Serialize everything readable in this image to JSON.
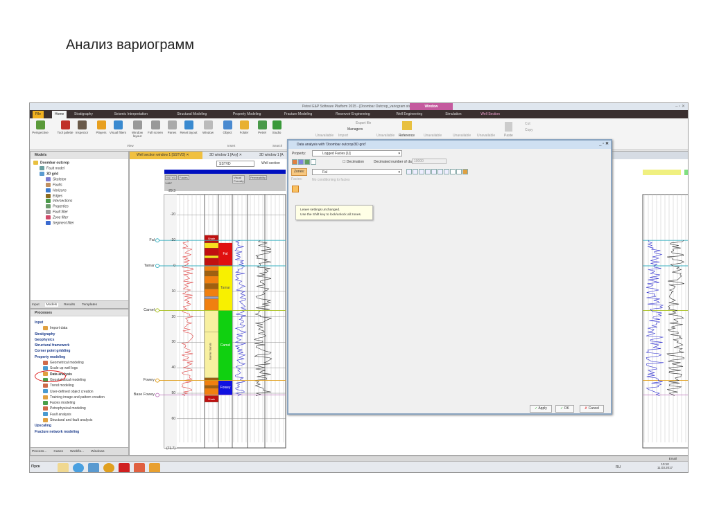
{
  "slide_title": "Анализ вариограмм",
  "window_title": "Petrel E&P Software Platform 2015 - [Doombar Outcrop_variogram study]",
  "context_tab": "Window",
  "ribbon_tabs": [
    "File",
    "Home",
    "Stratigraphy",
    "Seismic Interpretation",
    "Structural Modeling",
    "Property Modeling",
    "Fracture Modeling",
    "Reservoir Engineering",
    "Well Engineering",
    "Simulation",
    "Well Section"
  ],
  "ribbon_buttons": [
    {
      "label": "Perspective",
      "color": "#5a9a3a"
    },
    {
      "label": "Tool palette",
      "color": "#c0302a"
    },
    {
      "label": "Inspector",
      "color": "#6a5a4a"
    },
    {
      "label": "Players",
      "color": "#e8a020"
    },
    {
      "label": "Visual filters",
      "color": "#3a8ad0"
    },
    {
      "label": "Window layout",
      "color": "#999999"
    },
    {
      "label": "Full screen",
      "color": "#999999"
    },
    {
      "label": "Panes",
      "color": "#aaaaaa"
    },
    {
      "label": "Reset layout",
      "color": "#3a8ad0"
    },
    {
      "label": "Window",
      "color": "#bbbbbb"
    },
    {
      "label": "Object",
      "color": "#4a8ad0"
    },
    {
      "label": "Folder",
      "color": "#e8b030"
    },
    {
      "label": "Petrel",
      "color": "#4a9a4a"
    },
    {
      "label": "Studio",
      "color": "#3a9a3a"
    }
  ],
  "ribbon_groups": {
    "view": "View",
    "insert": "Insert",
    "search": "Search"
  },
  "ribbon_right": {
    "unavailable": "Unavailable",
    "import": "Import",
    "export": "Export file",
    "managers": "Managers",
    "reference": "Reference",
    "paste": "Paste",
    "cut": "Cut",
    "copy": "Copy"
  },
  "models_panel": {
    "title": "Models",
    "items": [
      {
        "label": "Doombar outcrop",
        "level": 0,
        "color": "#e8c040",
        "bold": true
      },
      {
        "label": "Fault model",
        "level": 1,
        "color": "#6aa0a0"
      },
      {
        "label": "3D grid",
        "level": 1,
        "color": "#5a9ad0",
        "bold": true
      },
      {
        "label": "Skeleton",
        "level": 2,
        "color": "#7a7ad0"
      },
      {
        "label": "Faults",
        "level": 2,
        "color": "#c09060"
      },
      {
        "label": "Horizons",
        "level": 2,
        "color": "#3a7ad0"
      },
      {
        "label": "Edges",
        "level": 2,
        "color": "#8a6a20"
      },
      {
        "label": "Intersections",
        "level": 2,
        "color": "#4a9a4a"
      },
      {
        "label": "Properties",
        "level": 2,
        "color": "#6a9a6a"
      },
      {
        "label": "Fault filter",
        "level": 2,
        "color": "#999999"
      },
      {
        "label": "Zone filter",
        "level": 2,
        "color": "#d04a6a"
      },
      {
        "label": "Segment filter",
        "level": 2,
        "color": "#3a6ad0"
      }
    ],
    "tabs": [
      "Input",
      "Models",
      "Results",
      "Templates"
    ]
  },
  "processes_panel": {
    "title": "Processes",
    "items": [
      {
        "label": "Input",
        "level": 0
      },
      {
        "label": "Import data",
        "level": 1
      },
      {
        "label": "Stratigraphy",
        "level": 0
      },
      {
        "label": "Geophysics",
        "level": 0
      },
      {
        "label": "Structural framework",
        "level": 0
      },
      {
        "label": "Corner point gridding",
        "level": 0
      },
      {
        "label": "Property modeling",
        "level": 0
      },
      {
        "label": "Geometrical modeling",
        "level": 1
      },
      {
        "label": "Scale up well logs",
        "level": 1
      },
      {
        "label": "Data analysis",
        "level": 1
      },
      {
        "label": "Geostatistical modeling",
        "level": 1
      },
      {
        "label": "Trend modeling",
        "level": 1
      },
      {
        "label": "User-defined object creation",
        "level": 1
      },
      {
        "label": "Training image and pattern creation",
        "level": 1
      },
      {
        "label": "Facies modeling",
        "level": 1
      },
      {
        "label": "Petrophysical modeling",
        "level": 1
      },
      {
        "label": "Fault analysis",
        "level": 1
      },
      {
        "label": "Structural and fault analysis",
        "level": 1
      },
      {
        "label": "Upscaling",
        "level": 0
      },
      {
        "label": "Fracture network modeling",
        "level": 0
      }
    ],
    "highlighted": "Data analysis",
    "tabs": [
      "Process...",
      "Cases",
      "Workflo...",
      "Windows"
    ]
  },
  "window_tabs": [
    "Well section window 1 [SSTVD]",
    "3D window 1 [Any]",
    "3D window 1 [A"
  ],
  "well_toolbar": {
    "domain": "SSTVD",
    "template": "Well section"
  },
  "well_header": {
    "cols": [
      "SSTVD",
      "Facies",
      "Visual Porosity",
      "Permeability"
    ],
    "scale": "1:667"
  },
  "depth_ticks": [
    "-29.3",
    "-20",
    "-10",
    "0",
    "10",
    "20",
    "30",
    "40",
    "50",
    "60",
    "(71.7)"
  ],
  "markers": [
    "Fal",
    "Tamar",
    "Camel",
    "Fowey",
    "Base Fowey"
  ],
  "zones": [
    {
      "label": "Fal",
      "color": "#e01010"
    },
    {
      "label": "Tamar",
      "color": "#f8f000"
    },
    {
      "label": "Camel",
      "color": "#10d010"
    },
    {
      "label": "Fowey",
      "color": "#1010e0"
    }
  ],
  "facies_labels": {
    "shale": "Shale",
    "barrier": "Barrier Sands"
  },
  "dialog": {
    "title": "Data analysis with 'Doombar outcrop/3D grid'",
    "property_label": "Property:",
    "property_value": "Logged Facies [U]",
    "decimation_label": "Decimation",
    "decimated_label": "Decimated number of data:",
    "decimated_value": "10000",
    "zones_button": "Zones:",
    "zone_value": "Fal",
    "facies_button": "Facies:",
    "facies_text": "No conditioning to facies",
    "tooltip_line1": "Leave settings unchanged.",
    "tooltip_line2": "Use the Shift key to lock/unlock all zones.",
    "apply": "Apply",
    "ok": "OK",
    "cancel": "Cancel"
  },
  "status": {
    "zoom": "Email"
  },
  "taskbar": {
    "start": "Пуск",
    "lang": "RU",
    "time": "10:10",
    "date": "11.03.2017"
  }
}
